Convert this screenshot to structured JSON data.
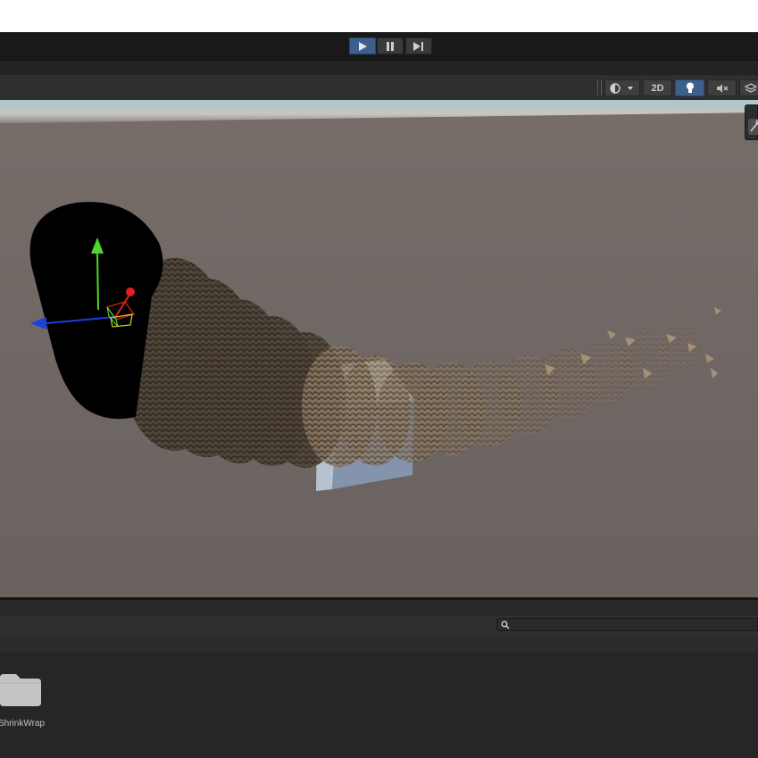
{
  "toolbar": {
    "play_icon": "play-icon",
    "pause_icon": "pause-icon",
    "step_icon": "step-icon"
  },
  "scene_toolbar": {
    "shading_icon": "shading-mode-icon",
    "dropdown_icon": "chevron-down-icon",
    "mode_2d_label": "2D",
    "lighting_icon": "lightbulb-icon",
    "audio_icon": "audio-mute-icon",
    "effects_icon": "effects-layers-icon"
  },
  "scene": {
    "gizmo_tool_icon": "tools-icon",
    "axis_colors": {
      "y": "#4fd62a",
      "x": "#e0201c",
      "z": "#1c3fe0"
    }
  },
  "project": {
    "search_placeholder": "",
    "folder_name": "ShrinkWrap",
    "folder_icon": "folder-icon"
  },
  "colors": {
    "accent": "#3d5f8c",
    "panel": "#282828",
    "toolbar": "#191919"
  }
}
